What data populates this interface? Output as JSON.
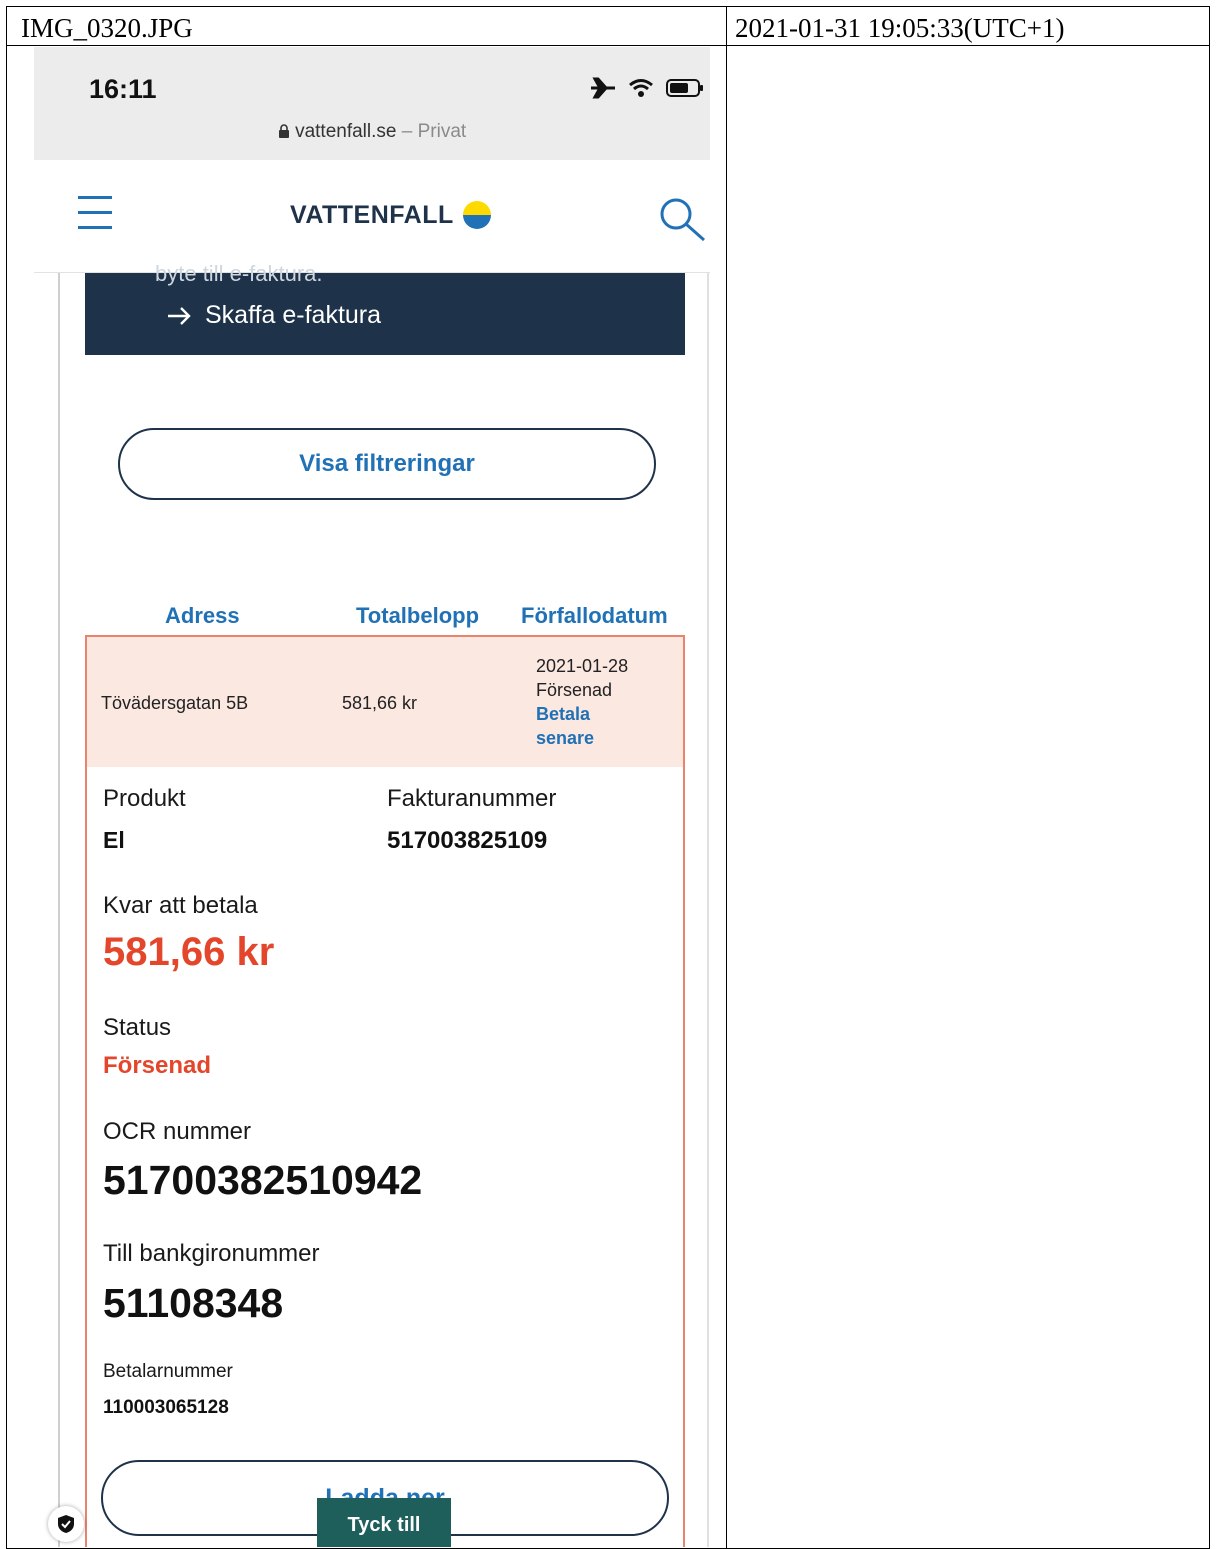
{
  "document": {
    "filename": "IMG_0320.JPG",
    "timestamp": "2021-01-31 19:05:33(UTC+1)"
  },
  "status_bar": {
    "time": "16:11",
    "url": "vattenfall.se",
    "url_suffix": "– Privat"
  },
  "nav": {
    "logo_text": "VATTENFALL",
    "menu_icon": "hamburger-icon",
    "search_icon": "search-icon"
  },
  "banner": {
    "cut_text": "byte till e-faktura.",
    "link_label": "Skaffa e-faktura"
  },
  "filter_button": "Visa filtreringar",
  "columns": [
    "Adress",
    "Totalbelopp",
    "Förfallodatum"
  ],
  "invoice": {
    "address": "Tövädersgatan 5B",
    "total": "581,66 kr",
    "due_date": "2021-01-28",
    "due_status": "Försenad",
    "pay_later_1": "Betala",
    "pay_later_2": "senare",
    "product_label": "Produkt",
    "product_value": "El",
    "invoice_number_label": "Fakturanummer",
    "invoice_number_value": "517003825109",
    "remaining_label": "Kvar att betala",
    "remaining_value": "581,66 kr",
    "status_label": "Status",
    "status_value": "Försenad",
    "ocr_label": "OCR nummer",
    "ocr_value": "51700382510942",
    "bankgiro_label": "Till bankgironummer",
    "bankgiro_value": "51108348",
    "payer_label": "Betalarnummer",
    "payer_value": "110003065128",
    "download_label": "Ladda ner"
  },
  "feedback_tab": "Tyck till",
  "colors": {
    "brand_navy": "#1e324a",
    "link_blue": "#2071b5",
    "alert_red": "#e4462c",
    "row_highlight": "#fbe8e1",
    "feedback_green": "#1f5f5b"
  }
}
